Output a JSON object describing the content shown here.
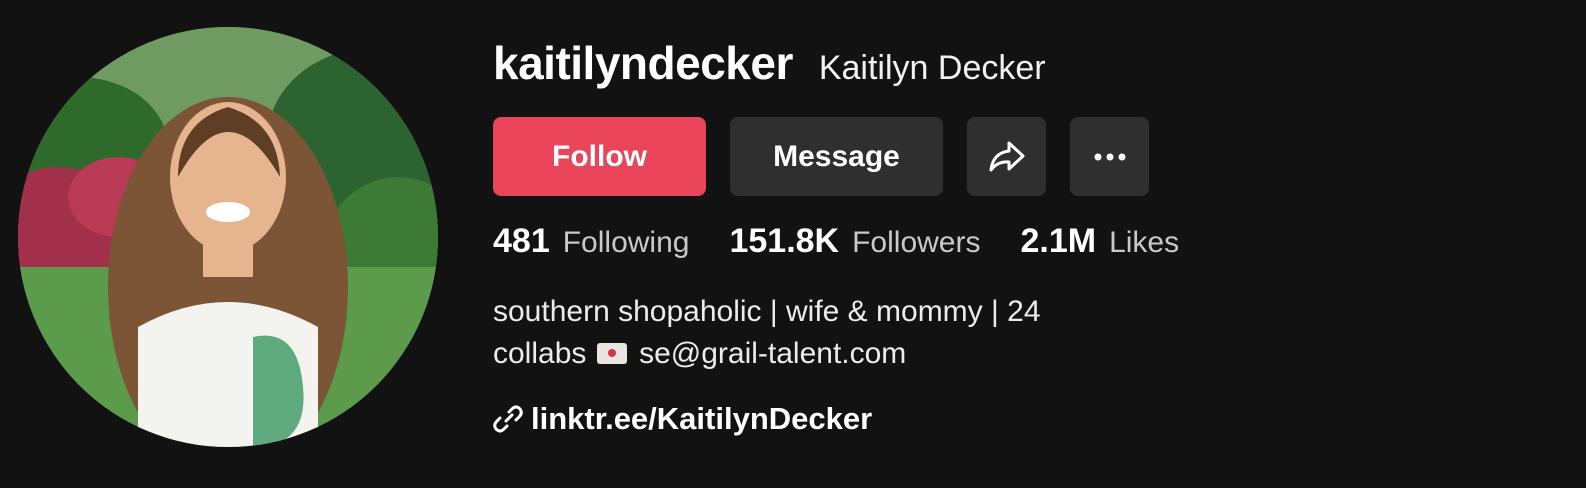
{
  "profile": {
    "username": "kaitilyndecker",
    "nickname": "Kaitilyn Decker"
  },
  "actions": {
    "follow_label": "Follow",
    "message_label": "Message",
    "share_icon": "share-icon",
    "more_icon": "more-icon"
  },
  "stats": [
    {
      "value": "481",
      "label": "Following"
    },
    {
      "value": "151.8K",
      "label": "Followers"
    },
    {
      "value": "2.1M",
      "label": "Likes"
    }
  ],
  "bio": {
    "line1": "southern shopaholic | wife & mommy | 24",
    "line2_before": "collabs",
    "line2_icon": "love-letter-icon",
    "line2_after": "se@grail-talent.com"
  },
  "link": {
    "icon": "link-icon",
    "text": "linktr.ee/KaitilynDecker"
  },
  "colors": {
    "background": "#121212",
    "follow_button": "#ea445a",
    "secondary_button": "#2f2f2f",
    "stat_label": "#c9c9c9"
  }
}
